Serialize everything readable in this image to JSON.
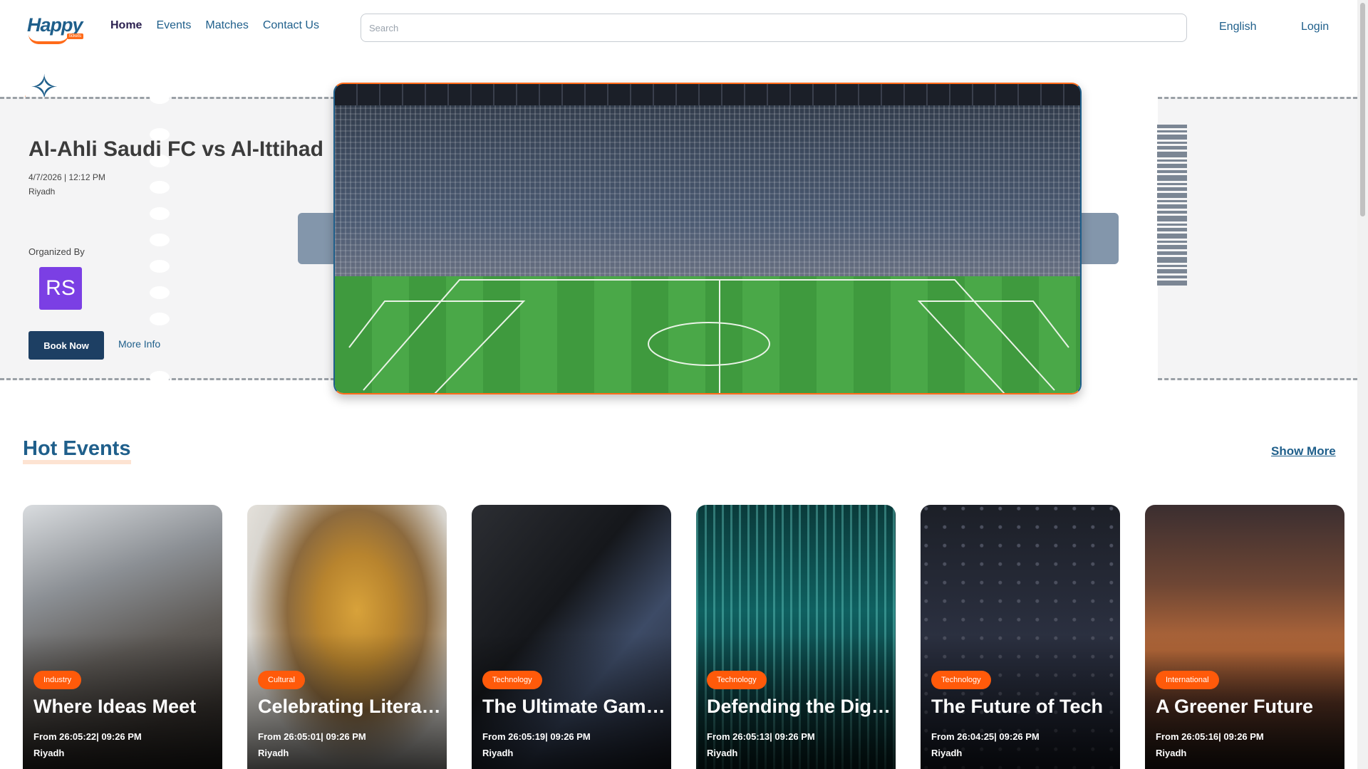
{
  "header": {
    "logo_text": "Happy",
    "logo_badge": "tickets",
    "nav": [
      "Home",
      "Events",
      "Matches",
      "Contact Us"
    ],
    "search_placeholder": "Search",
    "language": "English",
    "login": "Login"
  },
  "hero": {
    "title": "Al-Ahli Saudi FC vs Al-Ittihad",
    "date": "4/7/2026 | 12:12 PM",
    "city": "Riyadh",
    "organized_by_label": "Organized By",
    "organizer_initials": "RS",
    "book_now": "Book Now",
    "more_info": "More Info",
    "sparkle_glyph": "✧",
    "sparkle_small_glyph": "✧"
  },
  "hot_events": {
    "title": "Hot Events",
    "show_more": "Show More",
    "cards": [
      {
        "tag": "Industry",
        "title": "Where Ideas Meet",
        "from": "From 26:05:22| 09:26 PM",
        "city": "Riyadh"
      },
      {
        "tag": "Cultural",
        "title": "Celebrating Literature",
        "from": "From 26:05:01| 09:26 PM",
        "city": "Riyadh"
      },
      {
        "tag": "Technology",
        "title": "The Ultimate Gaming",
        "from": "From 26:05:19| 09:26 PM",
        "city": "Riyadh"
      },
      {
        "tag": "Technology",
        "title": "Defending the Digital",
        "from": "From 26:05:13| 09:26 PM",
        "city": "Riyadh"
      },
      {
        "tag": "Technology",
        "title": "The Future of Tech",
        "from": "From 26:04:25| 09:26 PM",
        "city": "Riyadh"
      },
      {
        "tag": "International",
        "title": "A Greener Future",
        "from": "From 26:05:16| 09:26 PM",
        "city": "Riyadh"
      }
    ]
  },
  "colors": {
    "brand_blue": "#1f5f8b",
    "accent_orange": "#ff6b1a",
    "button_dark": "#1d3f63",
    "avatar_purple": "#7b3fe4"
  }
}
